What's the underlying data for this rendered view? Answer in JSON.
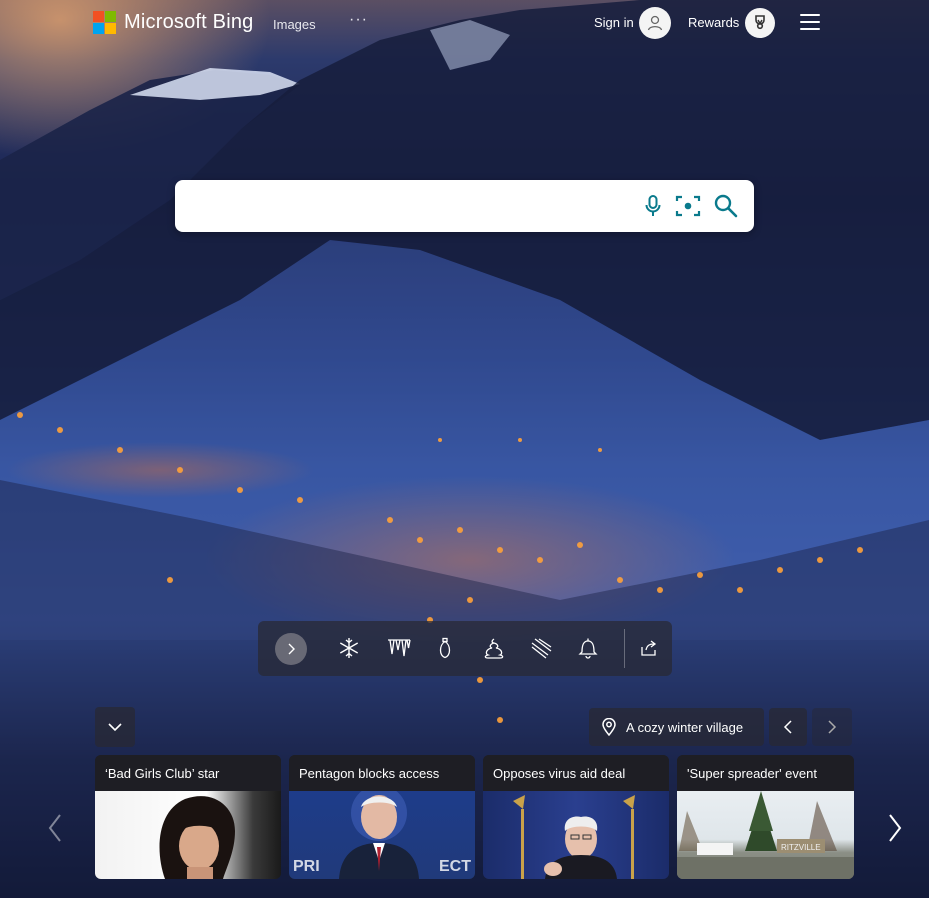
{
  "header": {
    "brand": "Microsoft Bing",
    "nav_images": "Images",
    "nav_more": "···",
    "sign_in": "Sign in",
    "rewards": "Rewards"
  },
  "search": {
    "placeholder": "",
    "value": ""
  },
  "toolbar": {
    "icons": [
      "chevron-right-icon",
      "snowflake-icon",
      "icicles-icon",
      "ornament-icon",
      "pile-icon",
      "slope-icon",
      "bell-icon",
      "share-icon"
    ]
  },
  "image_info": {
    "location_label": "A cozy winter village"
  },
  "news": [
    {
      "title": "‘Bad Girls Club’ star"
    },
    {
      "title": "Pentagon blocks access"
    },
    {
      "title": "Opposes virus aid deal"
    },
    {
      "title": "'Super spreader' event"
    }
  ],
  "colors": {
    "ms_red": "#f25022",
    "ms_green": "#7fba00",
    "ms_blue": "#00a4ef",
    "ms_yellow": "#ffb900",
    "search_icon_teal": "#0a7a8c"
  }
}
